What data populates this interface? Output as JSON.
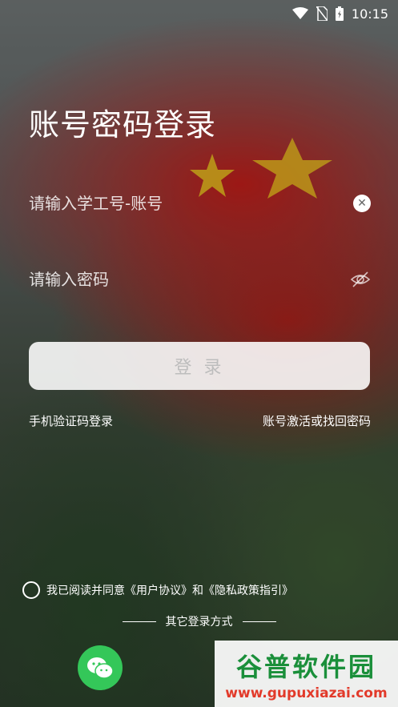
{
  "status_bar": {
    "time": "10:15",
    "icons": [
      "wifi-icon",
      "no-sim-icon",
      "battery-icon"
    ]
  },
  "title": "账号密码登录",
  "account_field": {
    "placeholder": "请输入学工号-账号",
    "value": ""
  },
  "password_field": {
    "placeholder": "请输入密码",
    "value": ""
  },
  "login_button": "登 录",
  "links": {
    "sms_login": "手机验证码登录",
    "activate_recover": "账号激活或找回密码"
  },
  "agreement": {
    "text": "我已阅读并同意《用户协议》和《隐私政策指引》",
    "checked": false
  },
  "other_login": {
    "label": "其它登录方式",
    "methods": [
      "wechat-icon"
    ]
  },
  "watermark": {
    "title": "谷普软件园",
    "url": "www.gupuxiazai.com"
  },
  "colors": {
    "accent_green": "#34c759",
    "flag_red": "#c41a16"
  }
}
